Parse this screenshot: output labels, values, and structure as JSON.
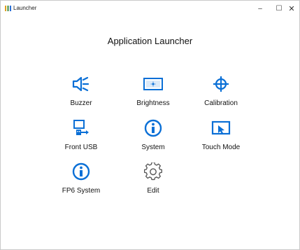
{
  "window": {
    "title": "Launcher",
    "minimize_glyph": "–",
    "maximize_glyph": "☐",
    "close_glyph": "✕"
  },
  "main": {
    "heading": "Application Launcher",
    "tiles": [
      {
        "label": "Buzzer",
        "icon": "speaker-icon"
      },
      {
        "label": "Brightness",
        "icon": "brightness-icon"
      },
      {
        "label": "Calibration",
        "icon": "crosshair-icon"
      },
      {
        "label": "Front USB",
        "icon": "usb-icon"
      },
      {
        "label": "System",
        "icon": "info-icon"
      },
      {
        "label": "Touch Mode",
        "icon": "touch-mode-icon"
      },
      {
        "label": "FP6 System",
        "icon": "info-icon"
      },
      {
        "label": "Edit",
        "icon": "gear-icon"
      }
    ]
  },
  "colors": {
    "accent": "#0a6fd6",
    "text": "#111111",
    "icon_gray": "#555555"
  }
}
